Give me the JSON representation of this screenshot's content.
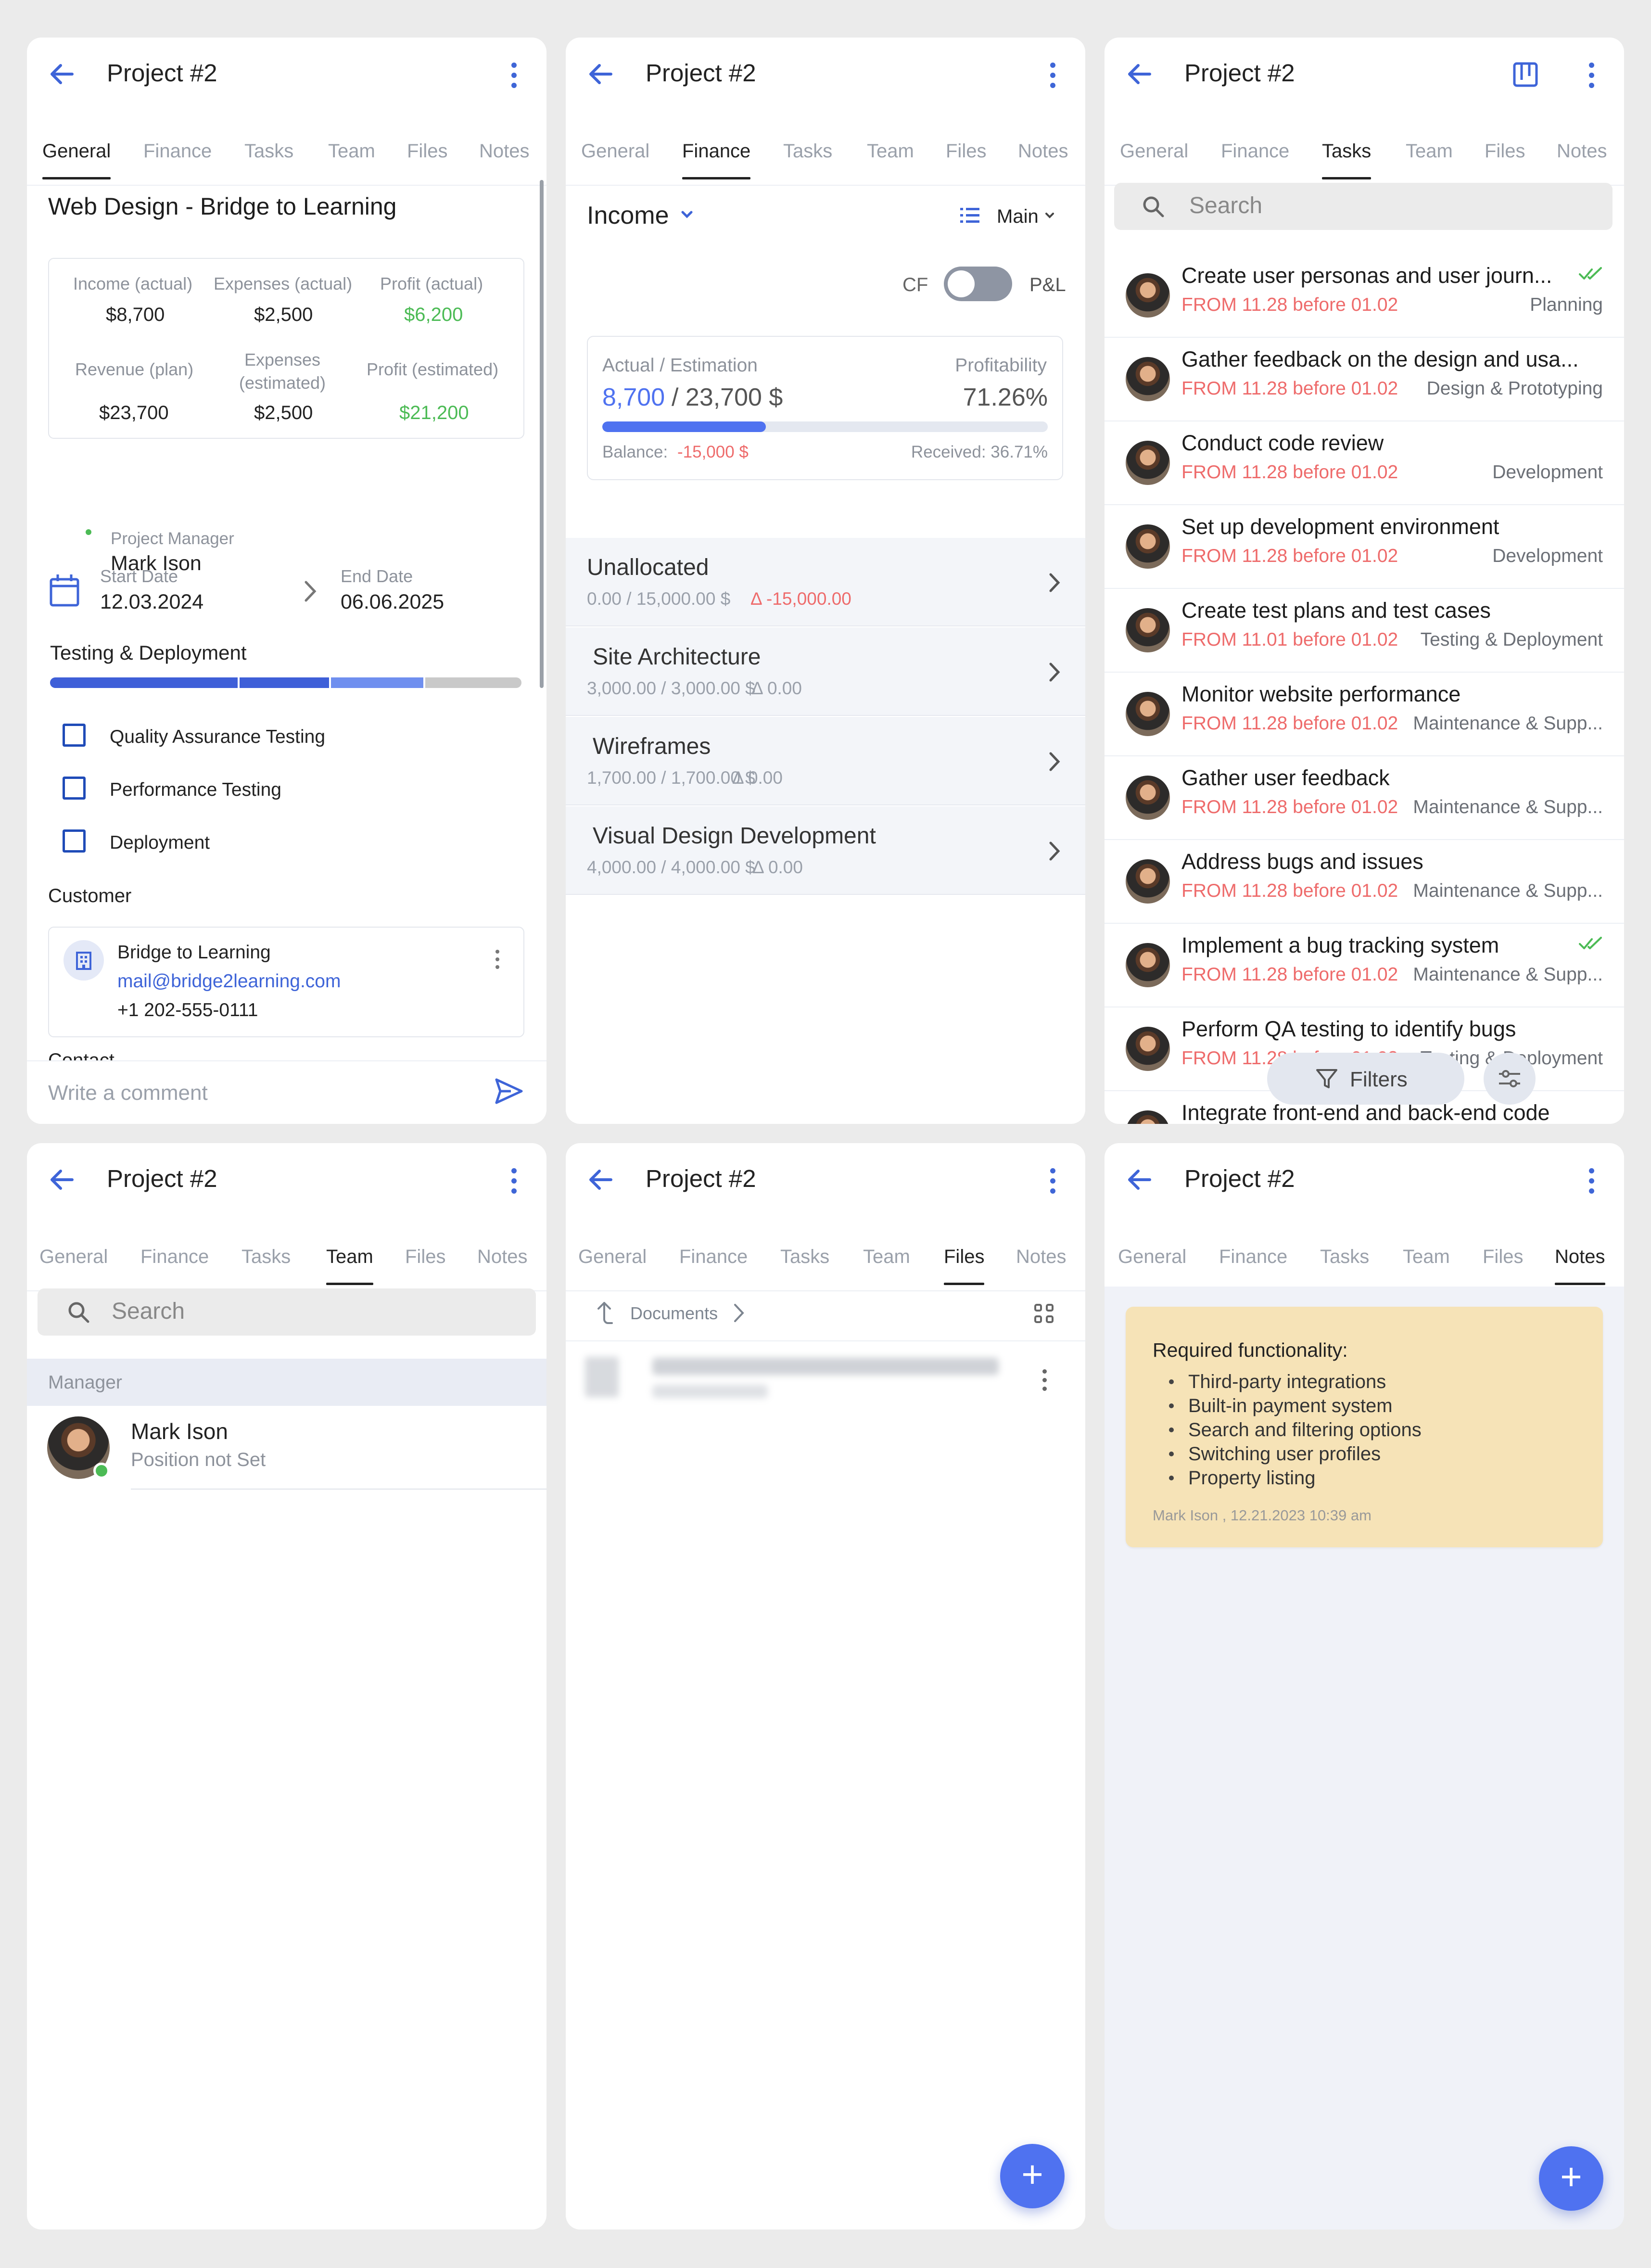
{
  "common": {
    "project_title": "Project #2",
    "tabs": [
      "General",
      "Finance",
      "Tasks",
      "Team",
      "Files",
      "Notes"
    ]
  },
  "general": {
    "project_name": "Web Design - Bridge to Learning",
    "summary": [
      {
        "label": "Income (actual)",
        "value": "$8,700"
      },
      {
        "label": "Expenses (actual)",
        "value": "$2,500"
      },
      {
        "label": "Profit (actual)",
        "value": "$6,200"
      },
      {
        "label": "Revenue (plan)",
        "value": "$23,700"
      },
      {
        "label": "Expenses (estimated)",
        "value": "$2,500"
      },
      {
        "label": "Profit (estimated)",
        "value": "$21,200"
      }
    ],
    "manager_label": "Project Manager",
    "manager_name": "Mark Ison",
    "start_label": "Start Date",
    "start_value": "12.03.2024",
    "end_label": "End Date",
    "end_value": "06.06.2025",
    "stage": "Testing & Deployment",
    "checklist": [
      "Quality Assurance Testing",
      "Performance Testing",
      "Deployment"
    ],
    "customer_label": "Customer",
    "customer_name": "Bridge to Learning",
    "customer_email": "mail@bridge2learning.com",
    "customer_phone": "+1 202-555-0111",
    "contact_label": "Contact",
    "comment_placeholder": "Write a comment"
  },
  "finance": {
    "section": "Income",
    "view": "Main",
    "toggle_left": "CF",
    "toggle_right": "P&L",
    "actual_label": "Actual / Estimation",
    "actual_value": "8,700",
    "estimation_value": "/ 23,700 $",
    "profitability_label": "Profitability",
    "profitability_value": "71.26%",
    "progress_fraction": 0.367,
    "balance_label": "Balance:",
    "balance_value": "-15,000 $",
    "received": "Received: 36.71%",
    "rows": [
      {
        "name": "Unallocated",
        "amounts": "0.00 / 15,000.00 $",
        "delta": "Δ -15,000.00",
        "negative": true
      },
      {
        "name": "Site Architecture",
        "amounts": "3,000.00 / 3,000.00 $",
        "delta": "Δ 0.00",
        "negative": false
      },
      {
        "name": "Wireframes",
        "amounts": "1,700.00 / 1,700.00 $",
        "delta": "Δ 0.00",
        "negative": false
      },
      {
        "name": "Visual Design Development",
        "amounts": "4,000.00 / 4,000.00 $",
        "delta": "Δ 0.00",
        "negative": false
      }
    ]
  },
  "tasks": {
    "search_placeholder": "Search",
    "filters_label": "Filters",
    "items": [
      {
        "title": "Create user personas and user journ...",
        "dates": "FROM 11.28 before 01.02",
        "stage": "Planning",
        "done": true
      },
      {
        "title": "Gather feedback on the design and usa...",
        "dates": "FROM 11.28 before 01.02",
        "stage": "Design & Prototyping",
        "done": false
      },
      {
        "title": "Conduct code review",
        "dates": "FROM 11.28 before 01.02",
        "stage": "Development",
        "done": false
      },
      {
        "title": "Set up development environment",
        "dates": "FROM 11.28 before 01.02",
        "stage": "Development",
        "done": false
      },
      {
        "title": "Create test plans and test cases",
        "dates": "FROM 11.01 before 01.02",
        "stage": "Testing & Deployment",
        "done": false
      },
      {
        "title": "Monitor website performance",
        "dates": "FROM 11.28 before 01.02",
        "stage": "Maintenance & Supp...",
        "done": false
      },
      {
        "title": "Gather user feedback",
        "dates": "FROM 11.28 before 01.02",
        "stage": "Maintenance & Supp...",
        "done": false
      },
      {
        "title": "Address bugs and issues",
        "dates": "FROM 11.28 before 01.02",
        "stage": "Maintenance & Supp...",
        "done": false
      },
      {
        "title": "Implement a bug tracking system",
        "dates": "FROM 11.28 before 01.02",
        "stage": "Maintenance & Supp...",
        "done": true
      },
      {
        "title": "Perform QA testing to identify bugs",
        "dates": "FROM 11.28 before 01.02",
        "stage": "Testing & Deployment",
        "done": false
      },
      {
        "title": "Integrate front-end and back-end code",
        "dates": "",
        "stage": "",
        "done": false
      }
    ]
  },
  "team": {
    "search_placeholder": "Search",
    "group": "Manager",
    "member_name": "Mark Ison",
    "member_position": "Position not Set"
  },
  "files": {
    "breadcrumb": "Documents"
  },
  "notes": {
    "heading": "Required functionality:",
    "items": [
      "Third-party integrations",
      "Built-in payment system",
      "Search and filtering options",
      "Switching user profiles",
      "Property listing"
    ],
    "footer": "Mark Ison , 12.21.2023 10:39 am"
  },
  "colors": {
    "accent": "#4f72f0",
    "success": "#4cbb55",
    "danger": "#ee6b6b",
    "note_bg": "#f6e3b7"
  }
}
